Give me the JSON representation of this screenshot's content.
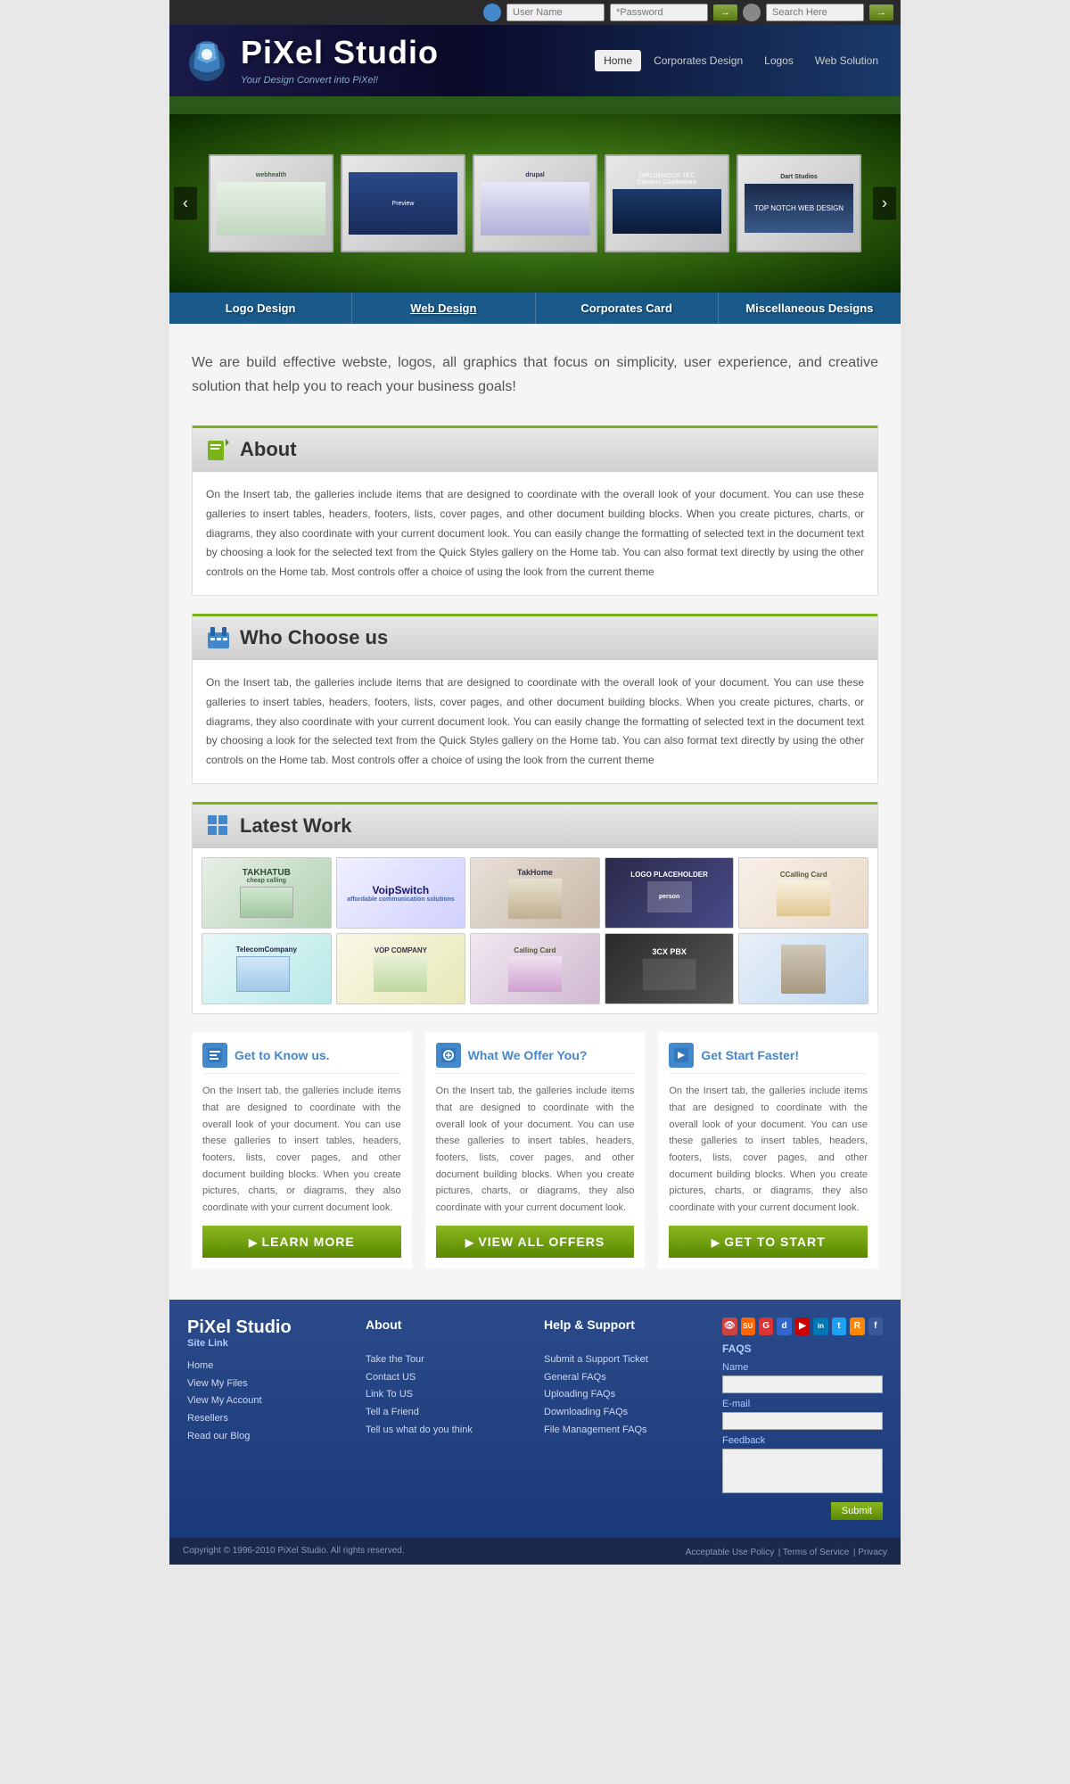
{
  "topbar": {
    "username_placeholder": "User Name",
    "password_placeholder": "*Password",
    "search_placeholder": "Search Here",
    "go_label": "→"
  },
  "header": {
    "logo_title": "PiXel Studio",
    "logo_subtitle": "Your Design Convert into PiXel!",
    "nav": [
      {
        "label": "Home",
        "active": true
      },
      {
        "label": "Corporates Design",
        "active": false
      },
      {
        "label": "Logos",
        "active": false
      },
      {
        "label": "Web Solution",
        "active": false
      }
    ]
  },
  "slider": {
    "left_arrow": "‹",
    "right_arrow": "›",
    "thumbs": [
      {
        "label": "webhealth",
        "class": "thumb1"
      },
      {
        "label": "Preview",
        "class": "thumb2"
      },
      {
        "label": "Drupal",
        "class": "thumb3"
      },
      {
        "label": "DIPLOMADOS TEC",
        "class": "thumb4"
      },
      {
        "label": "Dart Studios",
        "class": "thumb5"
      }
    ]
  },
  "categories": [
    {
      "label": "Logo Design"
    },
    {
      "label": "Web Design"
    },
    {
      "label": "Corporates Card"
    },
    {
      "label": "Miscellaneous Designs"
    }
  ],
  "intro": {
    "text": "We are build effective webste, logos, all graphics that focus on simplicity, user experience, and creative solution that help you to reach your business goals!"
  },
  "about": {
    "title": "About",
    "body": "On the Insert tab, the galleries include items that are designed to coordinate with the overall look of your document. You can use these galleries to insert tables, headers, footers, lists, cover pages, and other document building blocks. When you create pictures, charts, or diagrams, they also coordinate with your current document look. You can easily change the formatting of selected text in the document text by choosing a look for the selected text from the Quick Styles gallery on the Home tab. You can also format text directly by using the other controls on the Home tab. Most controls offer a choice of using the look from the current theme"
  },
  "who_choose": {
    "title": "Who Choose us",
    "body": "On the Insert tab, the galleries include items that are designed to coordinate with the overall look of your document. You can use these galleries to insert tables, headers, footers, lists, cover pages, and other document building blocks. When you create pictures, charts, or diagrams, they also coordinate with your current document look. You can easily change the formatting of selected text in the document text by choosing a look for the selected text from the Quick Styles gallery on the Home tab. You can also format text directly by using the other controls on the Home tab. Most controls offer a choice of using the look from the current theme"
  },
  "latest_work": {
    "title": "Latest Work",
    "thumbs": [
      {
        "label": "TAKHATUB",
        "class": "wt1"
      },
      {
        "label": "VoipSwitch",
        "class": "wt2"
      },
      {
        "label": "TakHome",
        "class": "wt3"
      },
      {
        "label": "LOGO PLACEHOLDER",
        "class": "wt4"
      },
      {
        "label": "Calling Card",
        "class": "wt5"
      },
      {
        "label": "TelecomCompany",
        "class": "wt6"
      },
      {
        "label": "VOP COMPANY",
        "class": "wt7"
      },
      {
        "label": "Calling Card",
        "class": "wt8"
      },
      {
        "label": "3CX PBX",
        "class": "wt9"
      },
      {
        "label": "Lady",
        "class": "wt10"
      }
    ]
  },
  "col1": {
    "title": "Get to Know us.",
    "body": "On the Insert tab, the galleries include items that are designed to coordinate with the overall look of your document. You can use these galleries to insert tables, headers, footers, lists, cover pages, and other document building blocks. When you create pictures, charts, or diagrams, they also coordinate with your current document look.",
    "btn": "LEARN MORE"
  },
  "col2": {
    "title": "What We Offer You?",
    "body": "On the Insert tab, the galleries include items that are designed to coordinate with the overall look of your document. You can use these galleries to insert tables, headers, footers, lists, cover pages, and other document building blocks. When you create pictures, charts, or diagrams, they also coordinate with your current document look.",
    "btn": "View All Offers"
  },
  "col3": {
    "title": "Get Start Faster!",
    "body": "On the Insert tab, the galleries include items that are designed to coordinate with the overall look of your document. You can use these galleries to insert tables, headers, footers, lists, cover pages, and other document building blocks. When you create pictures, charts, or diagrams, they also coordinate with your current document look.",
    "btn": "Get To Start"
  },
  "footer": {
    "brand": "PiXel Studio",
    "brand_sub": "Site Link",
    "site_links": [
      "Home",
      "View My Files",
      "View My Account",
      "Resellers",
      "Read our Blog"
    ],
    "about_title": "About",
    "about_links": [
      "Take the Tour",
      "Contact US",
      "Link To US",
      "Tell a Friend",
      "Tell us what do you think"
    ],
    "support_title": "Help & Support",
    "support_links": [
      "Submit a Support Ticket",
      "General FAQs",
      "Uploading FAQs",
      "Downloading FAQs",
      "File Management FAQs"
    ],
    "faqs_title": "FAQS",
    "name_label": "Name",
    "email_label": "E-mail",
    "feedback_label": "Feedback",
    "submit_label": "Submit",
    "social_icons": [
      {
        "label": "eye",
        "color": "#cc4444"
      },
      {
        "label": "SU",
        "color": "#ff6600"
      },
      {
        "label": "G",
        "color": "#dd3333"
      },
      {
        "label": "d",
        "color": "#3366cc"
      },
      {
        "label": "▶",
        "color": "#cc0000"
      },
      {
        "label": "in",
        "color": "#0077b5"
      },
      {
        "label": "t",
        "color": "#1da1f2"
      },
      {
        "label": "R",
        "color": "#ff4500"
      },
      {
        "label": "f",
        "color": "#3b5998"
      }
    ],
    "copyright": "Copyright © 1996-2010 PiXel Studio. All rights reserved.",
    "bottom_links": [
      "Acceptable Use Policy",
      "Terms of Service",
      "Privacy"
    ]
  }
}
